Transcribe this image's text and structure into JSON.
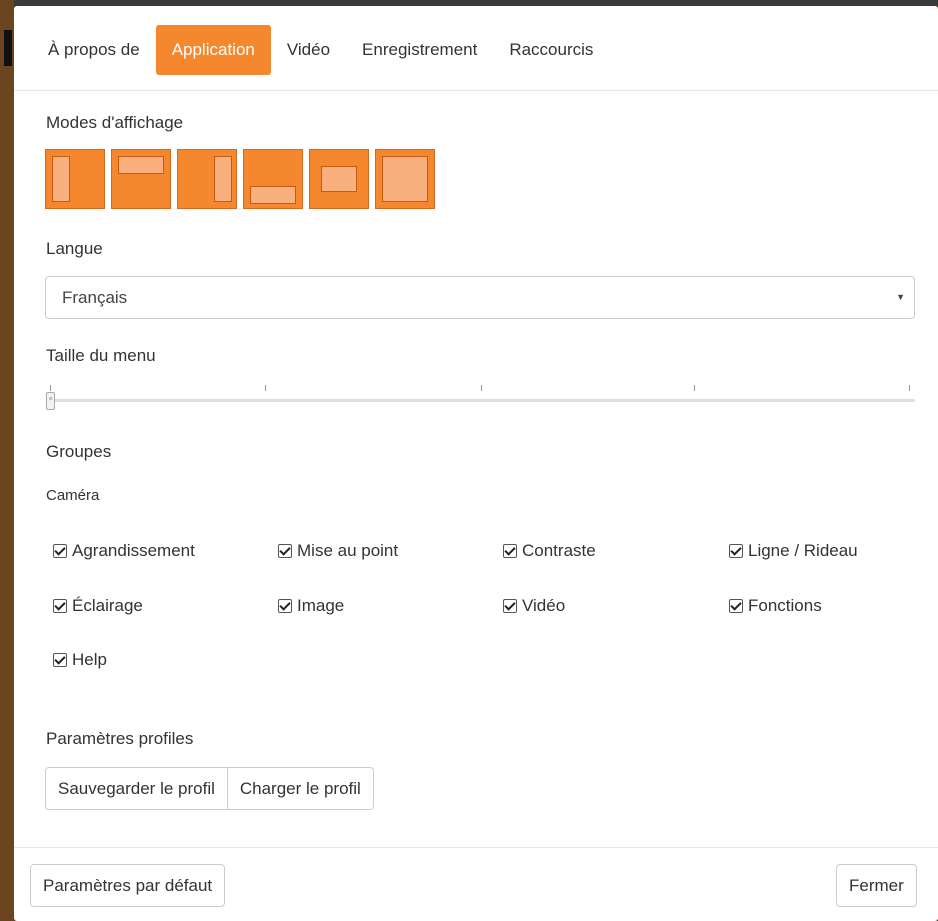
{
  "tabs": [
    {
      "label": "À propos de",
      "active": false
    },
    {
      "label": "Application",
      "active": true
    },
    {
      "label": "Vidéo",
      "active": false
    },
    {
      "label": "Enregistrement",
      "active": false
    },
    {
      "label": "Raccourcis",
      "active": false
    }
  ],
  "display_modes": {
    "label": "Modes d'affichage",
    "modes": [
      "mode-left-panel",
      "mode-top-panel",
      "mode-right-panel",
      "mode-bottom-panel",
      "mode-center-window",
      "mode-full"
    ]
  },
  "language": {
    "label": "Langue",
    "selected": "Français"
  },
  "menu_size": {
    "label": "Taille du menu",
    "value": 0,
    "ticks": 5
  },
  "groups": {
    "label": "Groupes",
    "camera_label": "Caméra",
    "items": [
      {
        "label": "Agrandissement",
        "checked": true
      },
      {
        "label": "Mise au point",
        "checked": true
      },
      {
        "label": "Contraste",
        "checked": true
      },
      {
        "label": "Ligne / Rideau",
        "checked": true
      },
      {
        "label": "Éclairage",
        "checked": true
      },
      {
        "label": "Image",
        "checked": true
      },
      {
        "label": "Vidéo",
        "checked": true
      },
      {
        "label": "Fonctions",
        "checked": true
      },
      {
        "label": "Help",
        "checked": true
      }
    ]
  },
  "profiles": {
    "label": "Paramètres profiles",
    "save_label": "Sauvegarder le profil",
    "load_label": "Charger le profil"
  },
  "footer": {
    "default_label": "Paramètres par défaut",
    "close_label": "Fermer"
  },
  "colors": {
    "accent": "#f5872f"
  }
}
